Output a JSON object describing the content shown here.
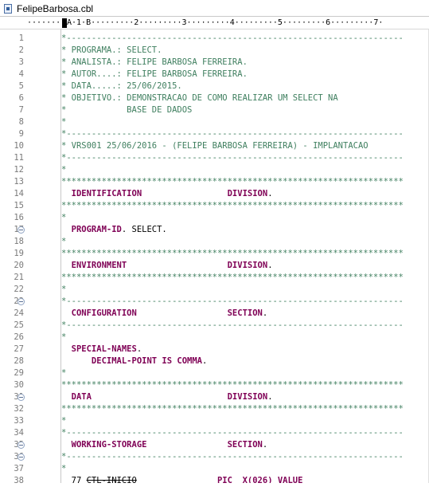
{
  "editor": {
    "tab_title": "FelipeBarbosa.cbl",
    "tab_icon": "cobol-file-icon"
  },
  "ruler": {
    "segments": [
      "·······",
      "A·1·B·········2·········3·········4·········5·········6·········7·"
    ]
  },
  "lines": [
    {
      "n": "1",
      "type": "sep-dash",
      "text": "*-------------------------------------------------------------------"
    },
    {
      "n": "2",
      "type": "comment",
      "text": "* PROGRAMA.: SELECT."
    },
    {
      "n": "3",
      "type": "comment",
      "text": "* ANALISTA.: FELIPE BARBOSA FERREIRA."
    },
    {
      "n": "4",
      "type": "comment",
      "text": "* AUTOR....: FELIPE BARBOSA FERREIRA."
    },
    {
      "n": "5",
      "type": "comment",
      "text": "* DATA.....: 25/06/2015."
    },
    {
      "n": "6",
      "type": "comment",
      "text": "* OBJETIVO.: DEMONSTRACAO DE COMO REALIZAR UM SELECT NA"
    },
    {
      "n": "7",
      "type": "comment",
      "text": "*            BASE DE DADOS"
    },
    {
      "n": "8",
      "type": "comment",
      "text": "*"
    },
    {
      "n": "9",
      "type": "sep-dash",
      "text": "*-------------------------------------------------------------------"
    },
    {
      "n": "10",
      "type": "comment",
      "text": "* VRS001 25/06/2016 - (FELIPE BARBOSA FERREIRA) - IMPLANTACAO"
    },
    {
      "n": "11",
      "type": "sep-dash",
      "text": "*-------------------------------------------------------------------"
    },
    {
      "n": "12",
      "type": "comment",
      "text": "*"
    },
    {
      "n": "13",
      "type": "sep-star",
      "text": "********************************************************************"
    },
    {
      "n": "14",
      "type": "code",
      "kw": "IDENTIFICATION                 DIVISION",
      "rest": "."
    },
    {
      "n": "15",
      "type": "sep-star",
      "text": "********************************************************************"
    },
    {
      "n": "16",
      "type": "comment",
      "text": "*"
    },
    {
      "n": "17",
      "type": "code",
      "kw": "PROGRAM-ID",
      "rest": ". SELECT.",
      "fold": true
    },
    {
      "n": "18",
      "type": "comment",
      "text": "*"
    },
    {
      "n": "19",
      "type": "sep-star",
      "text": "********************************************************************"
    },
    {
      "n": "20",
      "type": "code",
      "kw": "ENVIRONMENT                    DIVISION",
      "rest": "."
    },
    {
      "n": "21",
      "type": "sep-star",
      "text": "********************************************************************"
    },
    {
      "n": "22",
      "type": "comment",
      "text": "*"
    },
    {
      "n": "23",
      "type": "sep-dash",
      "text": "*-------------------------------------------------------------------",
      "fold": true
    },
    {
      "n": "24",
      "type": "code",
      "kw": "CONFIGURATION                  SECTION",
      "rest": "."
    },
    {
      "n": "25",
      "type": "sep-dash",
      "text": "*-------------------------------------------------------------------"
    },
    {
      "n": "26",
      "type": "comment",
      "text": "*"
    },
    {
      "n": "27",
      "type": "code",
      "kw": "SPECIAL-NAMES",
      "rest": "."
    },
    {
      "n": "28",
      "type": "code",
      "kw": "    DECIMAL-POINT IS COMMA",
      "rest": "."
    },
    {
      "n": "29",
      "type": "comment",
      "text": "*"
    },
    {
      "n": "30",
      "type": "sep-star",
      "text": "********************************************************************"
    },
    {
      "n": "31",
      "type": "code",
      "kw": "DATA                           DIVISION",
      "rest": ".",
      "fold": true
    },
    {
      "n": "32",
      "type": "sep-star",
      "text": "********************************************************************"
    },
    {
      "n": "33",
      "type": "comment",
      "text": "*"
    },
    {
      "n": "34",
      "type": "sep-dash",
      "text": "*-------------------------------------------------------------------"
    },
    {
      "n": "35",
      "type": "code",
      "kw": "WORKING-STORAGE                SECTION",
      "rest": ".",
      "fold": true
    },
    {
      "n": "36",
      "type": "sep-dash",
      "text": "*-------------------------------------------------------------------",
      "fold": true
    },
    {
      "n": "37",
      "type": "comment",
      "text": "*"
    },
    {
      "n": "38",
      "type": "last",
      "a": "77 ",
      "b": "CTL-INICIO",
      "c": "                PIC  X(026) ",
      "d": "VALUE"
    }
  ]
}
